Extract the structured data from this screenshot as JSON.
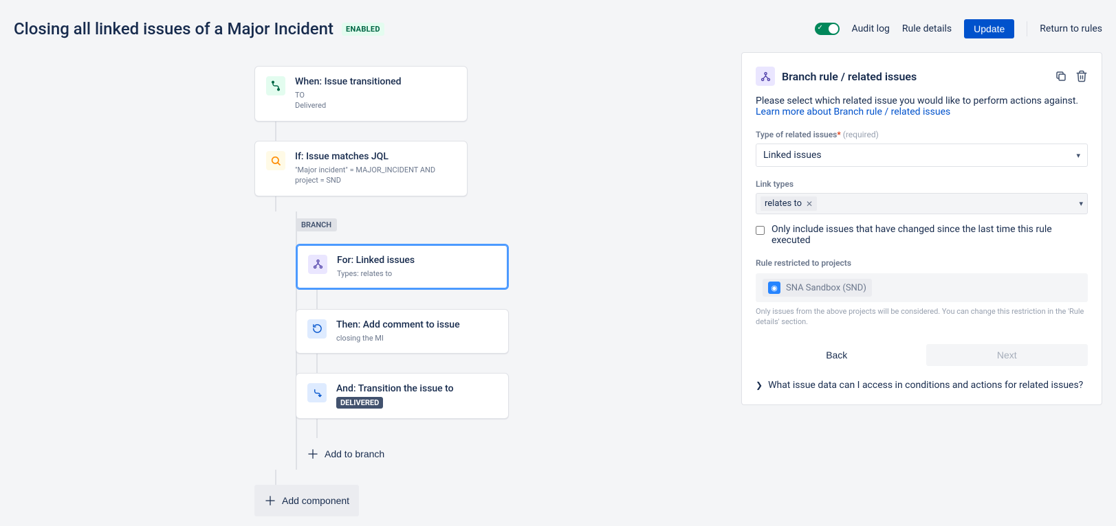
{
  "header": {
    "title": "Closing all linked issues of a Major Incident",
    "enabled_badge": "ENABLED",
    "audit_log": "Audit log",
    "rule_details": "Rule details",
    "update": "Update",
    "return": "Return to rules"
  },
  "flow": {
    "trigger": {
      "title": "When: Issue transitioned",
      "sub1": "TO",
      "sub2": "Delivered"
    },
    "condition": {
      "title": "If: Issue matches JQL",
      "sub": "\"Major incident\" = MAJOR_INCIDENT AND project = SND"
    },
    "branch_label": "BRANCH",
    "branch_for": {
      "title": "For: Linked issues",
      "sub": "Types: relates to"
    },
    "action_comment": {
      "title": "Then: Add comment to issue",
      "sub": "closing the MI"
    },
    "action_transition": {
      "title": "And: Transition the issue to",
      "status": "DELIVERED"
    },
    "add_to_branch": "Add to branch",
    "add_component": "Add component"
  },
  "panel": {
    "title": "Branch rule / related issues",
    "desc_prefix": "Please select which related issue you would like to perform actions against. ",
    "desc_link": "Learn more about Branch rule / related issues",
    "type_label": "Type of related issues",
    "type_required_hint": "(required)",
    "type_value": "Linked issues",
    "link_types_label": "Link types",
    "link_type_tag": "relates to",
    "only_include": "Only include issues that have changed since the last time this rule executed",
    "restricted_label": "Rule restricted to projects",
    "project_name": "SNA Sandbox (SND)",
    "restricted_hint": "Only issues from the above projects will be considered. You can change this restriction in the 'Rule details' section.",
    "back": "Back",
    "next": "Next",
    "accordion": "What issue data can I access in conditions and actions for related issues?"
  }
}
